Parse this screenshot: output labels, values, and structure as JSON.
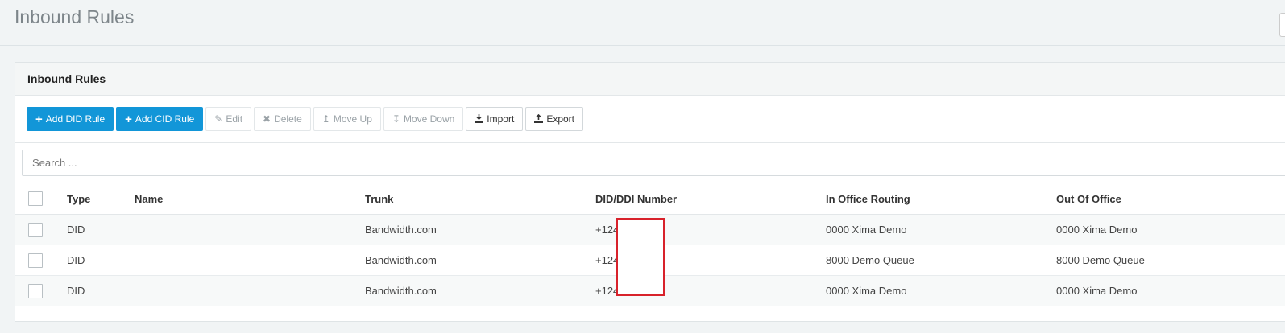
{
  "page": {
    "title": "Inbound Rules"
  },
  "panel": {
    "heading": "Inbound Rules"
  },
  "toolbar": {
    "add_did": "Add DID Rule",
    "add_cid": "Add CID Rule",
    "edit": "Edit",
    "delete": "Delete",
    "move_up": "Move Up",
    "move_down": "Move Down",
    "import": "Import",
    "export": "Export"
  },
  "search": {
    "placeholder": "Search ..."
  },
  "table": {
    "headers": {
      "type": "Type",
      "name": "Name",
      "trunk": "Trunk",
      "did": "DID/DDI Number",
      "in_office": "In Office Routing",
      "out_office": "Out Of Office"
    },
    "rows": [
      {
        "type": "DID",
        "name": "",
        "trunk": "Bandwidth.com",
        "did": "+124",
        "in_office": "0000 Xima Demo",
        "out_office": "0000 Xima Demo"
      },
      {
        "type": "DID",
        "name": "",
        "trunk": "Bandwidth.com",
        "did": "+124",
        "in_office": "8000 Demo Queue",
        "out_office": "8000 Demo Queue"
      },
      {
        "type": "DID",
        "name": "",
        "trunk": "Bandwidth.com",
        "did": "+124",
        "in_office": "0000 Xima Demo",
        "out_office": "0000 Xima Demo"
      }
    ]
  },
  "colors": {
    "primary": "#1296d8",
    "redaction_border": "#d8222b"
  },
  "icons": {
    "add": "plus-icon",
    "edit": "pencil-icon",
    "delete": "x-icon",
    "move_up": "arrow-up-icon",
    "move_down": "arrow-down-icon",
    "import": "download-icon",
    "export": "upload-icon"
  }
}
